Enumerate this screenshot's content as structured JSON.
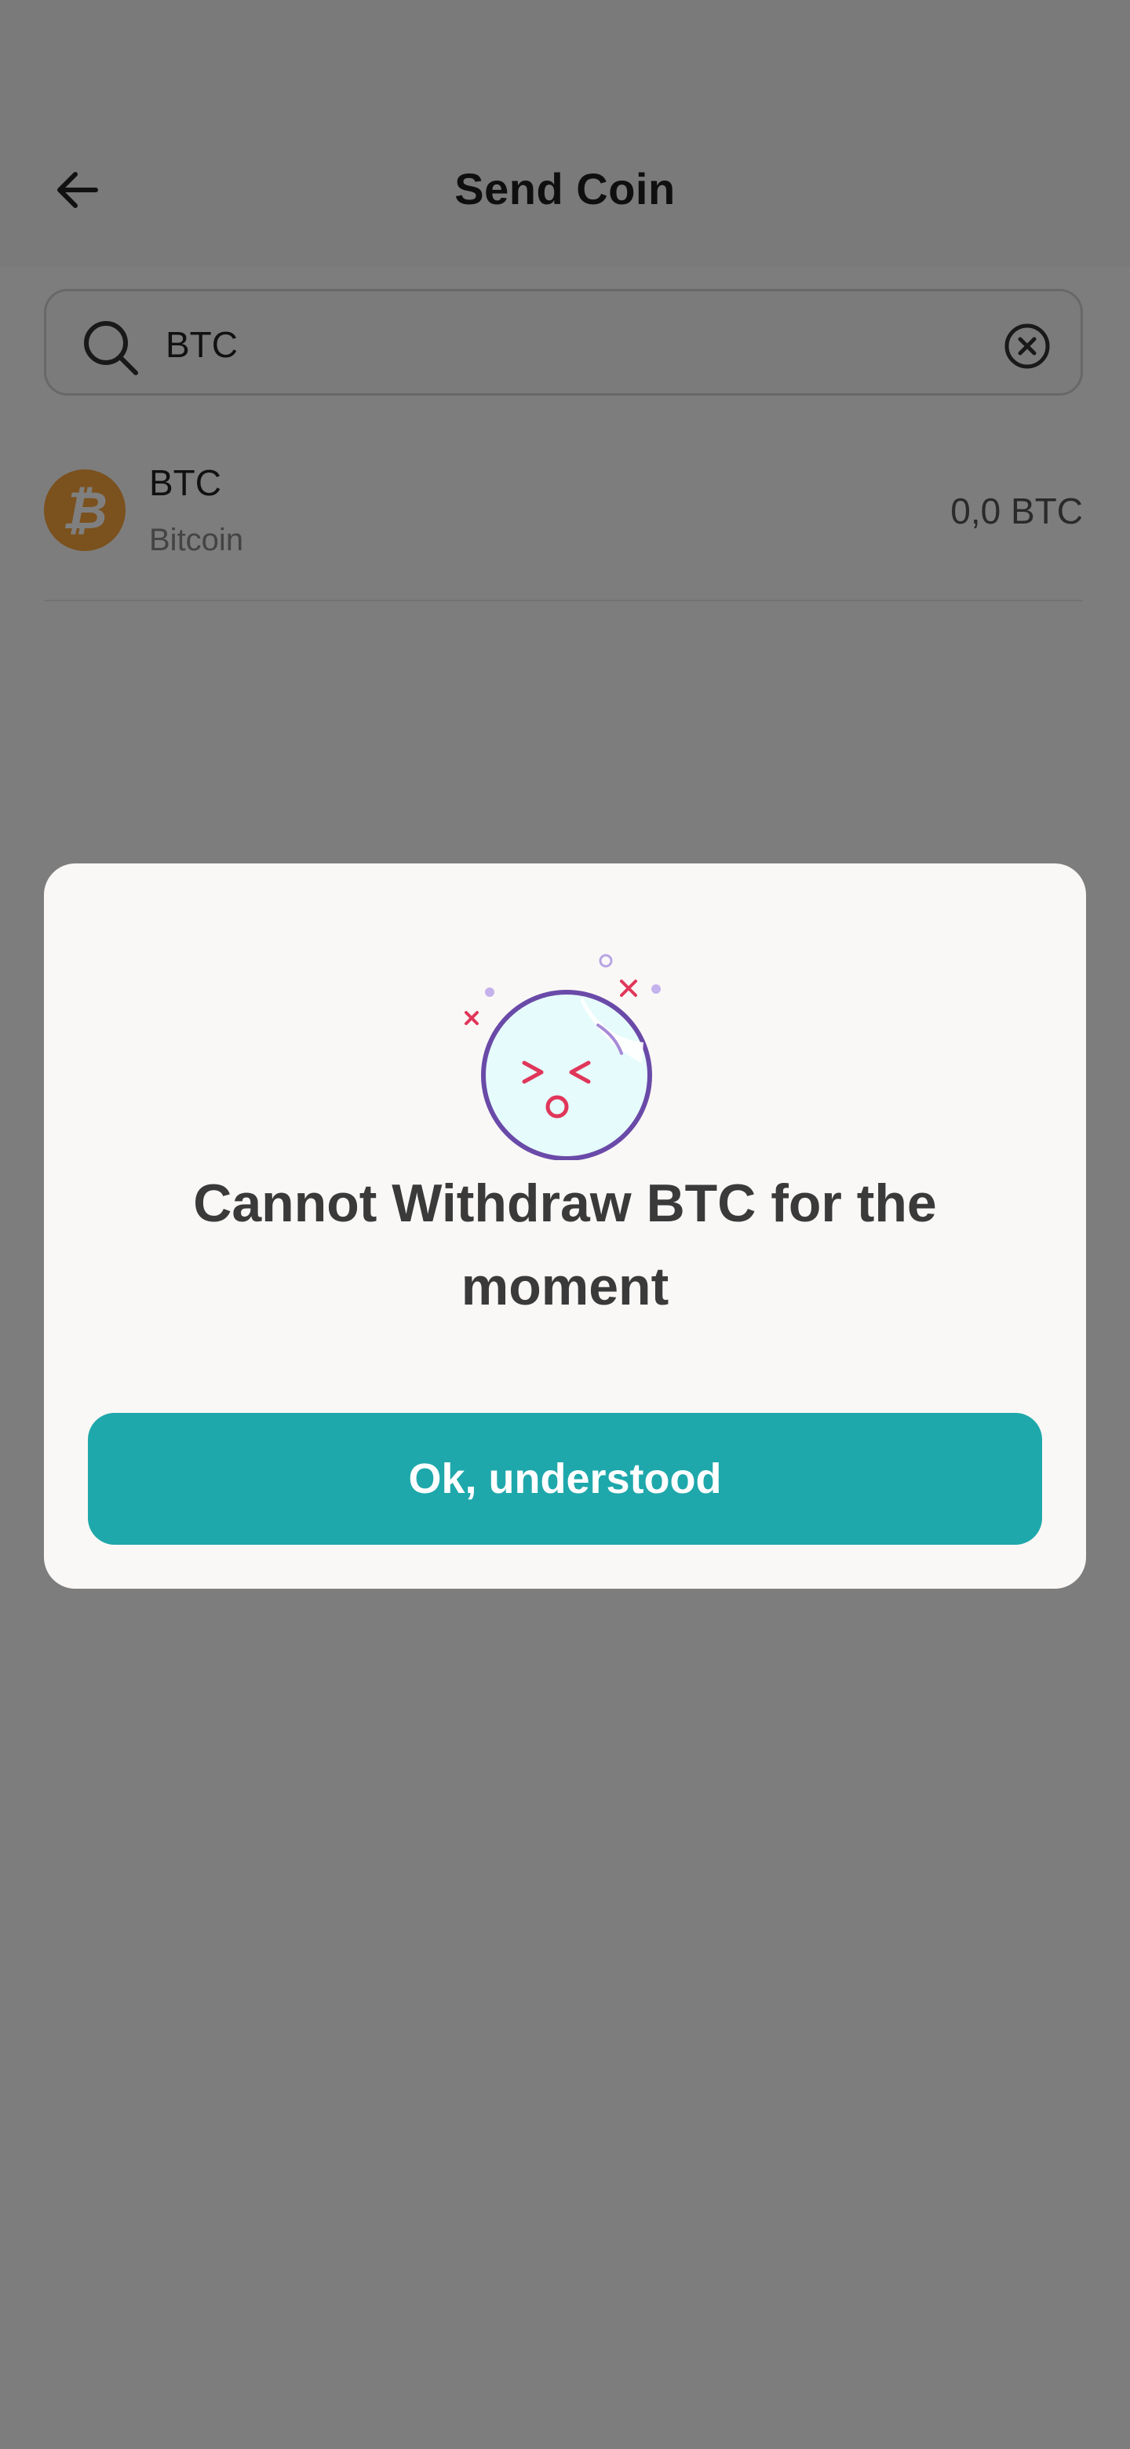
{
  "header": {
    "title": "Send Coin",
    "back_icon": "arrow-left-icon"
  },
  "search": {
    "value": "BTC",
    "icons": [
      "search-icon",
      "clear-circle-icon"
    ]
  },
  "coins": [
    {
      "symbol": "BTC",
      "name": "Bitcoin",
      "balance": "0,0 BTC",
      "logo_glyph": "₿",
      "logo_color": "#f7a33a"
    }
  ],
  "dialog": {
    "illustration": "confused-face-icon",
    "title": "Cannot Withdraw BTC for the moment",
    "button_label": "Ok, understood"
  },
  "colors": {
    "accent": "#1fa8ab",
    "backdrop": "rgba(0,0,0,0.5)",
    "illustration_outline": "#6a4aa8",
    "illustration_face": "#e0365a"
  }
}
